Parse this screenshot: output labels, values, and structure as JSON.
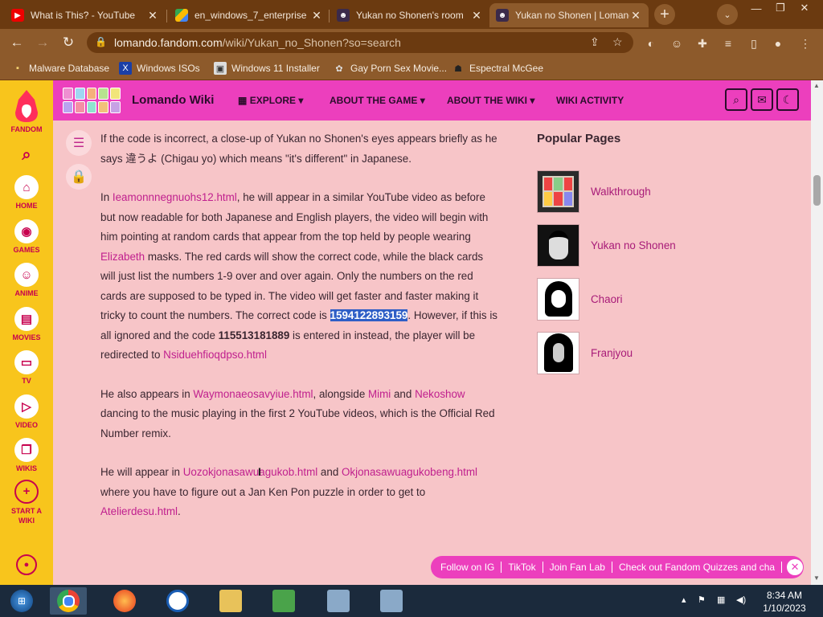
{
  "browser": {
    "tabs": [
      {
        "label": "What is This? - YouTube",
        "icon": "youtube-icon",
        "active": false
      },
      {
        "label": "en_windows_7_enterprise",
        "icon": "drive-icon",
        "active": false
      },
      {
        "label": "Yukan no Shonen's room",
        "icon": "yukan-icon",
        "active": false
      },
      {
        "label": "Yukan no Shonen | Lomando",
        "icon": "yukan-icon",
        "active": true
      }
    ],
    "new_tab": "+",
    "url_host": "lomando.fandom.com",
    "url_path": "/wiki/Yukan_no_Shonen?so=search",
    "bookmarks": [
      {
        "label": "Malware Database",
        "icon": "malware-icon"
      },
      {
        "label": "Windows ISOs",
        "icon": "x-icon"
      },
      {
        "label": "Windows 11 Installer",
        "icon": "installer-icon"
      },
      {
        "label": "Gay Porn Sex Movie...",
        "icon": "site-icon"
      },
      {
        "label": "Espectral McGee",
        "icon": "ghost-icon"
      }
    ]
  },
  "rail": {
    "brand": "FANDOM",
    "items": [
      {
        "label": "HOME",
        "icon": "home-icon"
      },
      {
        "label": "GAMES",
        "icon": "gamepad-icon"
      },
      {
        "label": "ANIME",
        "icon": "anime-icon"
      },
      {
        "label": "MOVIES",
        "icon": "clapperboard-icon"
      },
      {
        "label": "TV",
        "icon": "tv-icon"
      },
      {
        "label": "VIDEO",
        "icon": "video-icon"
      },
      {
        "label": "WIKIS",
        "icon": "book-icon"
      },
      {
        "label": "START A WIKI",
        "icon": "plus-circle-icon"
      }
    ]
  },
  "wiki": {
    "title": "Lomando Wiki",
    "nav": [
      "EXPLORE",
      "ABOUT THE GAME",
      "ABOUT THE WIKI",
      "WIKI ACTIVITY"
    ]
  },
  "article": {
    "p1": "If the code is incorrect, a close-up of Yukan no Shonen's eyes appears briefly as he says 違うよ (Chigau yo) which means \"it's different\" in Japanese.",
    "p2_a": "In ",
    "p2_link1": "Ieamonnnegnuohs12.html",
    "p2_b": ", he will appear in a similar YouTube video as before but now readable for both Japanese and English players, the video will begin with him pointing at random cards that appear from the top held by people wearing ",
    "p2_link2": "Elizabeth",
    "p2_c": " masks. The red cards will show the correct code, while the black cards will just list the numbers 1-9 over and over again. Only the numbers on the red cards are supposed to be typed in. The video will get faster and faster making it tricky to count the numbers. The correct code is ",
    "p2_selected": "1594122893159",
    "p2_d": ". However, if this is all ignored and the code ",
    "p2_code2": "115513181889",
    "p2_e": " is entered in instead, the player will be redirected to ",
    "p2_link3": "Nsiduehfioqdpso.html",
    "p3_a": "He also appears in ",
    "p3_link1": "Waymonaeosavyiue.html",
    "p3_b": ", alongside ",
    "p3_link2": "Mimi",
    "p3_c": " and ",
    "p3_link3": "Nekoshow",
    "p3_d": " dancing to the music playing in the first 2 YouTube videos, which is the Official Red Number remix.",
    "p4_a": "He will appear in ",
    "p4_link1": "Uozokjonasawuagukob.html",
    "p4_b": " and ",
    "p4_link2": "Okjonasawuagukobeng.html",
    "p4_c": " where you have to figure out a Jan Ken Pon puzzle in order to get to ",
    "p4_link3": "Atelierdesu.html",
    "p4_d": "."
  },
  "popular": {
    "title": "Popular Pages",
    "items": [
      "Walkthrough",
      "Yukan no Shonen",
      "Chaori",
      "Franjyou"
    ]
  },
  "social": [
    "Follow on IG",
    "TikTok",
    "Join Fan Lab",
    "Check out Fandom Quizzes and cha"
  ],
  "clock": {
    "time": "8:34 AM",
    "date": "1/10/2023"
  }
}
